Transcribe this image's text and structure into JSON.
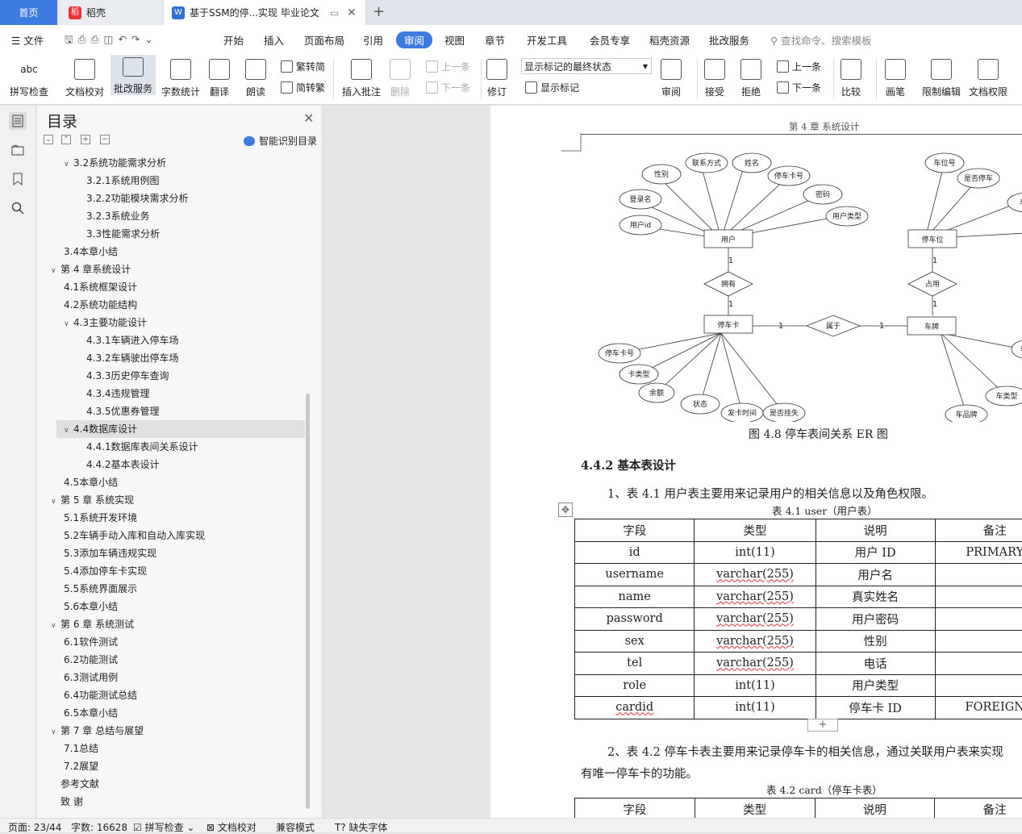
{
  "tabs": {
    "home": "首页",
    "wk": "稻壳",
    "doc": "基于SSM的停...实现 毕业论文"
  },
  "menu": {
    "file": "文件",
    "items": [
      "开始",
      "插入",
      "页面布局",
      "引用",
      "审阅",
      "视图",
      "章节",
      "开发工具",
      "会员专享",
      "稻壳资源",
      "批改服务"
    ],
    "active": "审阅",
    "search": "查找命令、搜索模板"
  },
  "ribbon": {
    "spell": "拼写检查",
    "proof": "文档校对",
    "correct": "批改服务",
    "wordcount": "字数统计",
    "translate": "翻译",
    "read": "朗读",
    "t2s": "繁转简",
    "s2t": "简转繁",
    "comment": "插入批注",
    "delete": "删除",
    "prev_c": "上一条",
    "next_c": "下一条",
    "track": "修订",
    "markup_state": "显示标记的最终状态",
    "show_markup": "显示标记",
    "review": "审阅",
    "accept": "接受",
    "reject": "拒绝",
    "prev": "上一条",
    "next": "下一条",
    "compare": "比较",
    "pen": "画笔",
    "restrict": "限制编辑",
    "rights": "文档权限"
  },
  "toc": {
    "title": "目录",
    "smart": "智能识别目录",
    "items": [
      {
        "t": "3.2系统功能需求分析",
        "l": 1,
        "c": "v"
      },
      {
        "t": "3.2.1系统用例图",
        "l": 2
      },
      {
        "t": "3.2.2功能模块需求分析",
        "l": 2
      },
      {
        "t": "3.2.3系统业务",
        "l": 2
      },
      {
        "t": "3.3性能需求分析",
        "l": 2
      },
      {
        "t": "3.4本章小结",
        "l": 1
      },
      {
        "t": "第 4 章系统设计",
        "l": 0,
        "c": "v"
      },
      {
        "t": "4.1系统框架设计",
        "l": 1
      },
      {
        "t": "4.2系统功能结构",
        "l": 1
      },
      {
        "t": "4.3主要功能设计",
        "l": 1,
        "c": "v"
      },
      {
        "t": "4.3.1车辆进入停车场",
        "l": 2
      },
      {
        "t": "4.3.2车辆驶出停车场",
        "l": 2
      },
      {
        "t": "4.3.3历史停车查询",
        "l": 2
      },
      {
        "t": "4.3.4违规管理",
        "l": 2
      },
      {
        "t": "4.3.5优惠券管理",
        "l": 2
      },
      {
        "t": "4.4数据库设计",
        "l": 1,
        "c": "v",
        "sel": true
      },
      {
        "t": "4.4.1数据库表间关系设计",
        "l": 2
      },
      {
        "t": "4.4.2基本表设计",
        "l": 2
      },
      {
        "t": "4.5本章小结",
        "l": 1
      },
      {
        "t": "第 5 章  系统实现",
        "l": 0,
        "c": "v"
      },
      {
        "t": "5.1系统开发环境",
        "l": 1
      },
      {
        "t": "5.2车辆手动入库和自动入库实现",
        "l": 1
      },
      {
        "t": "5.3添加车辆违规实现",
        "l": 1
      },
      {
        "t": "5.4添加停车卡实现",
        "l": 1
      },
      {
        "t": "5.5系统界面展示",
        "l": 1
      },
      {
        "t": "5.6本章小结",
        "l": 1
      },
      {
        "t": "第 6 章  系统测试",
        "l": 0,
        "c": "v"
      },
      {
        "t": "6.1软件测试",
        "l": 1
      },
      {
        "t": "6.2功能测试",
        "l": 1
      },
      {
        "t": "6.3测试用例",
        "l": 1
      },
      {
        "t": "6.4功能测试总结",
        "l": 1
      },
      {
        "t": "6.5本章小结",
        "l": 1
      },
      {
        "t": "第 7 章  总结与展望",
        "l": 0,
        "c": "v"
      },
      {
        "t": "7.1总结",
        "l": 1
      },
      {
        "t": "7.2展望",
        "l": 1
      },
      {
        "t": "参考文献",
        "l": 0
      },
      {
        "t": "致    谢",
        "l": 0
      }
    ]
  },
  "doc": {
    "header": "第 4 章  系统设计",
    "er": {
      "user": "用户",
      "lot": "停车位",
      "card": "停车卡",
      "plate": "车牌",
      "own": "拥有",
      "occupy": "占用",
      "belong": "属于",
      "one": "1",
      "user_attrs": [
        "性别",
        "联系方式",
        "姓名",
        "停车卡号",
        "密码",
        "用户类型",
        "登录名",
        "用户id"
      ],
      "lot_attrs": [
        "车位号",
        "是否停车",
        "车位"
      ],
      "card_attrs": [
        "停车卡号",
        "卡类型",
        "余额",
        "状态",
        "发卡时间",
        "是否挂失"
      ],
      "plate_attrs": [
        "车",
        "车类型",
        "车品牌"
      ]
    },
    "fig_caption": "图  4.8  停车表间关系 ER 图",
    "heading": "4.4.2  基本表设计",
    "p1": "1、表 4.1 用户表主要用来记录用户的相关信息以及角色权限。",
    "t1_caption": "表 4.1 user（用户表）",
    "t1_header": [
      "字段",
      "类型",
      "说明",
      "备注"
    ],
    "t1_rows": [
      [
        "id",
        "int(11)",
        "用户 ID",
        "PRIMARY"
      ],
      [
        "username",
        "varchar(255)",
        "用户名",
        ""
      ],
      [
        "name",
        "varchar(255)",
        "真实姓名",
        ""
      ],
      [
        "password",
        "varchar(255)",
        "用户密码",
        ""
      ],
      [
        "sex",
        "varchar(255)",
        "性别",
        ""
      ],
      [
        "tel",
        "varchar(255)",
        "电话",
        ""
      ],
      [
        "role",
        "int(11)",
        "用户类型",
        ""
      ],
      [
        "cardid",
        "int(11)",
        "停车卡 ID",
        "FOREIGN"
      ]
    ],
    "p2a": "2、表 4.2 停车卡表主要用来记录停车卡的相关信息，通过关联用户表来实现",
    "p2b": "有唯一停车卡的功能。",
    "t2_caption": "表 4.2 card（停车卡表）",
    "t2_header": [
      "字段",
      "类型",
      "说明",
      "备注"
    ]
  },
  "status": {
    "page": "页面: 23/44",
    "words": "字数: 16628",
    "spell": "拼写检查",
    "proof": "文档校对",
    "compat": "兼容模式",
    "font": "缺失字体"
  }
}
